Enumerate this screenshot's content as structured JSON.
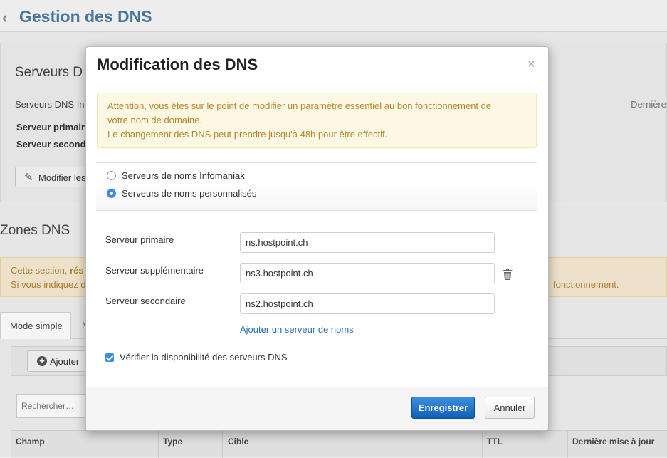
{
  "page": {
    "title": "Gestion des DNS",
    "back_icon": "chevron-left-icon"
  },
  "dns_panel": {
    "title": "Serveurs D",
    "info_label": "Serveurs DNS Inf",
    "right_label": "Dernière",
    "primary_label": "Serveur primaire",
    "secondary_label": "Serveur seconda",
    "modify_button": "Modifier les"
  },
  "zones": {
    "title": "Zones DNS",
    "warning_line1_a": "Cette section, ",
    "warning_line1_b": "rés",
    "warning_line2": "Si vous indiquez d",
    "warning_line2_right": "fonctionnement.",
    "tab_simple": "Mode simple",
    "tab_other": "M",
    "add_button": "Ajouter",
    "search_placeholder": "Rechercher…",
    "columns": [
      "Champ",
      "Type",
      "Cible",
      "TTL",
      "Dernière mise à jour"
    ]
  },
  "modal": {
    "title": "Modification des DNS",
    "close": "×",
    "alert_line1": "Attention, vous êtes sur le point de modifier un paramètre essentiel au bon fonctionnement de",
    "alert_line2": "votre nom de domaine.",
    "alert_line3": "Le changement des DNS peut prendre jusqu'à 48h pour être effectif.",
    "radio_infomaniak": "Serveurs de noms Infomaniak",
    "radio_custom": "Serveurs de noms personnalisés",
    "selected_radio": "custom",
    "primary_label": "Serveur primaire",
    "primary_value": "ns.hostpoint.ch",
    "additional_label": "Serveur supplémentaire",
    "additional_value": "ns3.hostpoint.ch",
    "secondary_label": "Serveur secondaire",
    "secondary_value": "ns2.hostpoint.ch",
    "add_server_link": "Ajouter un serveur de noms",
    "verify_label": "Vérifier la disponibilité des serveurs DNS",
    "verify_checked": true,
    "save_button": "Enregistrer",
    "cancel_button": "Annuler"
  },
  "colors": {
    "accent": "#3b8de6",
    "title_blue": "#4d7ba3",
    "link": "#2a6fb0",
    "warning_text": "#b7862f",
    "warning_bg": "#fcf8e3"
  }
}
